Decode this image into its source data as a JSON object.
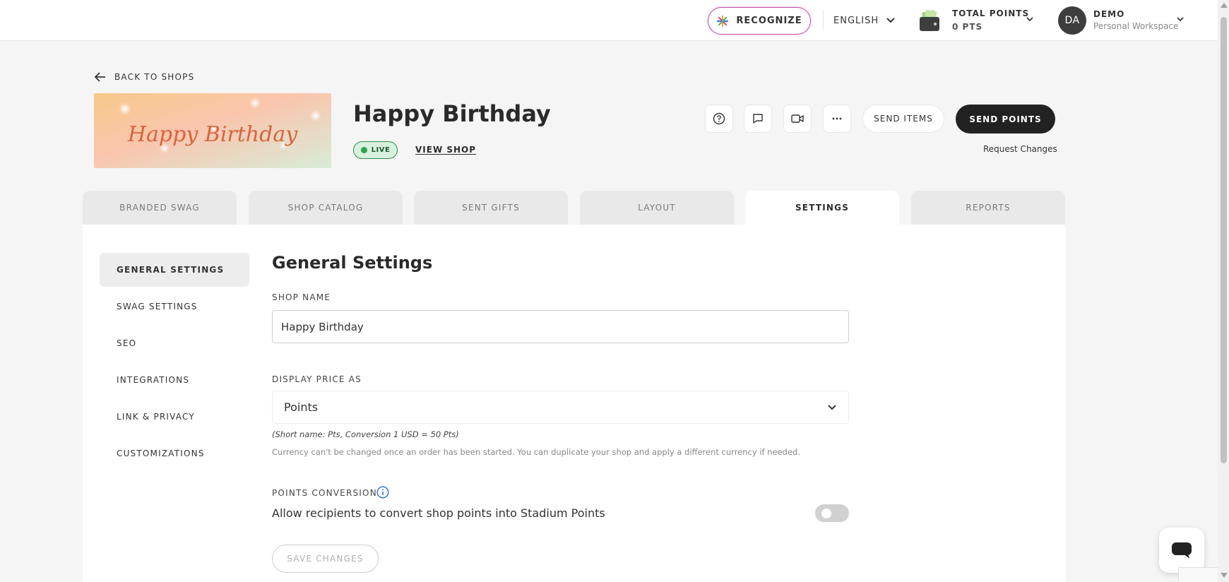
{
  "topbar": {
    "recognize_label": "RECOGNIZE",
    "language": "ENGLISH",
    "points_title": "TOTAL POINTS",
    "points_value": "0 PTS",
    "avatar_initials": "DA",
    "user_name": "DEMO",
    "workspace": "Personal Workspace"
  },
  "header": {
    "back_label": "BACK TO SHOPS",
    "banner_text": "Happy Birthday",
    "shop_title": "Happy Birthday",
    "status": "LIVE",
    "view_shop": "VIEW SHOP",
    "send_items": "SEND ITEMS",
    "send_points": "SEND POINTS",
    "request_changes": "Request Changes",
    "icons": [
      "help-icon",
      "comment-icon",
      "video-icon",
      "more-icon"
    ]
  },
  "tabs": [
    {
      "label": "BRANDED SWAG",
      "active": false
    },
    {
      "label": "SHOP CATALOG",
      "active": false
    },
    {
      "label": "SENT GIFTS",
      "active": false
    },
    {
      "label": "LAYOUT",
      "active": false
    },
    {
      "label": "SETTINGS",
      "active": true
    },
    {
      "label": "REPORTS",
      "active": false
    }
  ],
  "sidenav": [
    {
      "label": "GENERAL SETTINGS",
      "active": true
    },
    {
      "label": "SWAG SETTINGS",
      "active": false
    },
    {
      "label": "SEO",
      "active": false
    },
    {
      "label": "INTEGRATIONS",
      "active": false
    },
    {
      "label": "LINK & PRIVACY",
      "active": false
    },
    {
      "label": "CUSTOMIZATIONS",
      "active": false
    }
  ],
  "form": {
    "section_title": "General Settings",
    "shop_name_label": "SHOP NAME",
    "shop_name_value": "Happy Birthday",
    "display_price_label": "DISPLAY PRICE AS",
    "display_price_value": "Points",
    "short_name_hint": "(Short name: Pts, Conversion 1 USD = 50 Pts)",
    "currency_hint": "Currency can't be changed once an order has been started. You can duplicate your shop and apply a different currency if needed.",
    "points_conversion_label": "POINTS CONVERSION",
    "points_conversion_text": "Allow recipients to convert shop points into Stadium Points",
    "points_conversion_enabled": false,
    "save_label": "SAVE CHANGES"
  },
  "colors": {
    "primary_dark": "#222222",
    "live_green": "#2aa44f",
    "recognize_border": "#c14fa8",
    "banner_text": "#d8643e"
  }
}
